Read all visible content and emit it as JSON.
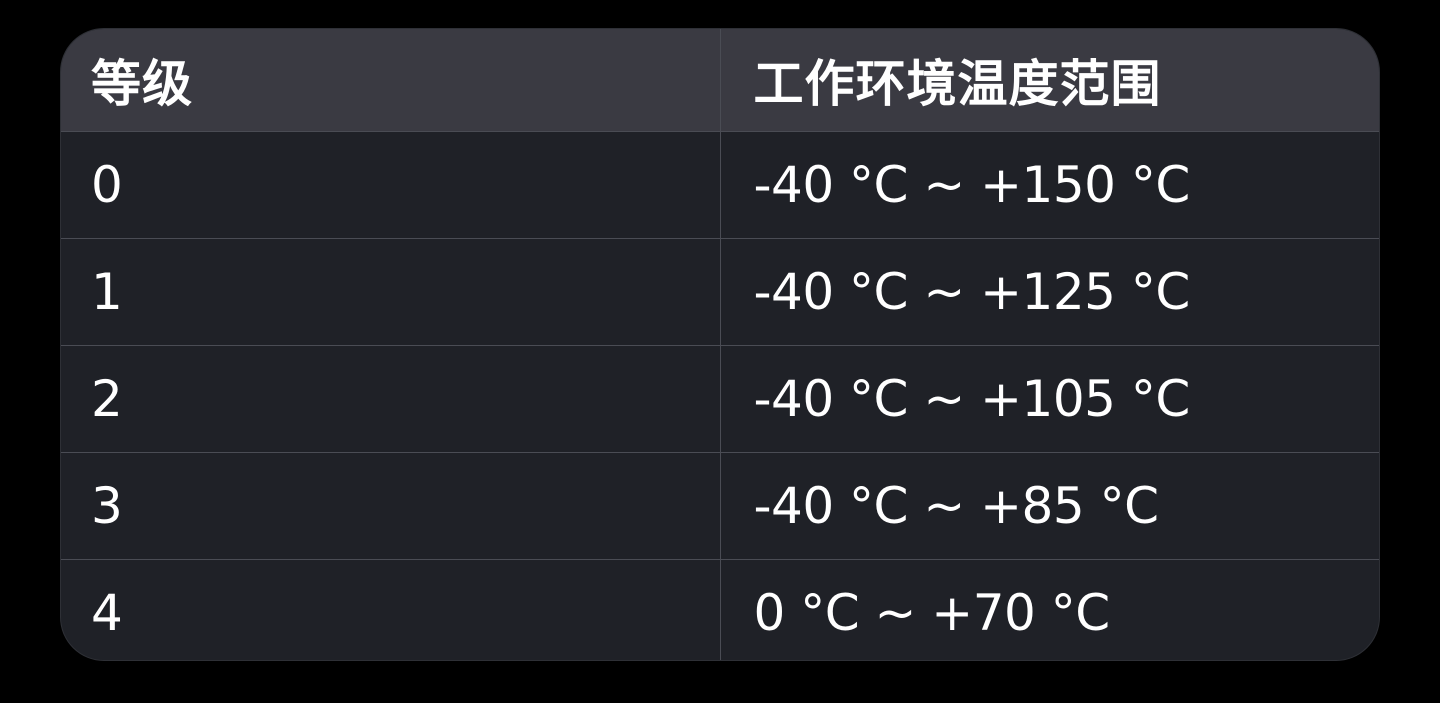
{
  "table": {
    "headers": [
      "等级",
      "工作环境温度范围"
    ],
    "rows": [
      [
        "0",
        "-40 °C ~ +150 °C"
      ],
      [
        "1",
        "-40 °C ~ +125 °C"
      ],
      [
        "2",
        "-40 °C ~ +105 °C"
      ],
      [
        "3",
        "-40 °C ~ +85 °C"
      ],
      [
        "4",
        "0 °C ~ +70 °C"
      ]
    ]
  },
  "colors": {
    "background": "#000000",
    "header_bg": "#3a3a42",
    "row_bg": "#1f2127",
    "grid": "#4a4c54",
    "text": "#ffffff"
  }
}
